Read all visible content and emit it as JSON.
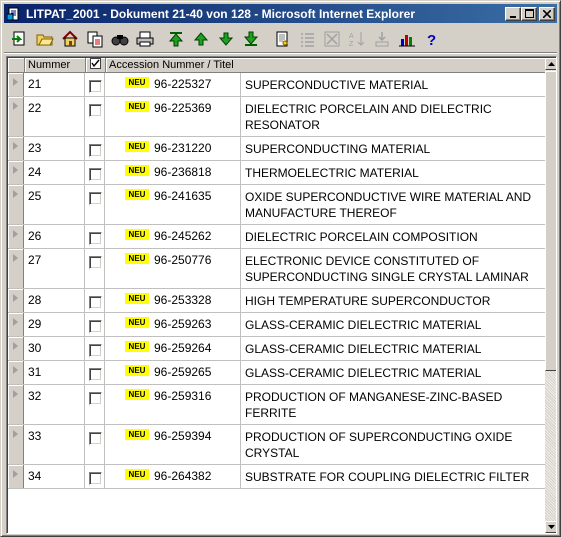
{
  "window": {
    "title": "LITPAT_2001 - Dokument 21-40 von 128 - Microsoft Internet Explorer"
  },
  "toolbar": {
    "buttons": [
      "export-icon",
      "open-folder-icon",
      "home-icon",
      "copy-doc-icon",
      "find-icon",
      "print-icon",
      "first-record-icon",
      "previous-record-icon",
      "next-record-icon",
      "last-record-icon",
      "document-icon",
      "list-icon",
      "delete-icon",
      "sort-icon",
      "download-icon",
      "chart-icon",
      "help-icon"
    ]
  },
  "grid": {
    "headers": {
      "number": "Nummer",
      "accession_title": "Accession Nummer / Titel"
    },
    "badge": "NEU",
    "rows": [
      {
        "num": "21",
        "acc": "96-225327",
        "title": "SUPERCONDUCTIVE MATERIAL"
      },
      {
        "num": "22",
        "acc": "96-225369",
        "title": "DIELECTRIC PORCELAIN AND DIELECTRIC RESONATOR"
      },
      {
        "num": "23",
        "acc": "96-231220",
        "title": "SUPERCONDUCTING MATERIAL"
      },
      {
        "num": "24",
        "acc": "96-236818",
        "title": "THERMOELECTRIC MATERIAL"
      },
      {
        "num": "25",
        "acc": "96-241635",
        "title": "OXIDE SUPERCONDUCTIVE WIRE MATERIAL AND MANUFACTURE THEREOF"
      },
      {
        "num": "26",
        "acc": "96-245262",
        "title": "DIELECTRIC PORCELAIN COMPOSITION"
      },
      {
        "num": "27",
        "acc": "96-250776",
        "title": "ELECTRONIC DEVICE CONSTITUTED OF SUPERCONDUCTING SINGLE CRYSTAL LAMINAR"
      },
      {
        "num": "28",
        "acc": "96-253328",
        "title": "HIGH TEMPERATURE SUPERCONDUCTOR"
      },
      {
        "num": "29",
        "acc": "96-259263",
        "title": "GLASS-CERAMIC DIELECTRIC MATERIAL"
      },
      {
        "num": "30",
        "acc": "96-259264",
        "title": "GLASS-CERAMIC DIELECTRIC MATERIAL"
      },
      {
        "num": "31",
        "acc": "96-259265",
        "title": "GLASS-CERAMIC DIELECTRIC MATERIAL"
      },
      {
        "num": "32",
        "acc": "96-259316",
        "title": "PRODUCTION OF MANGANESE-ZINC-BASED FERRITE"
      },
      {
        "num": "33",
        "acc": "96-259394",
        "title": "PRODUCTION OF SUPERCONDUCTING OXIDE CRYSTAL"
      },
      {
        "num": "34",
        "acc": "96-264382",
        "title": "SUBSTRATE FOR COUPLING DIELECTRIC FILTER"
      }
    ]
  },
  "colors": {
    "titlebar_start": "#0a246a",
    "titlebar_end": "#3a6ea5",
    "badge": "#ffff00",
    "chrome": "#d4d0c8"
  }
}
